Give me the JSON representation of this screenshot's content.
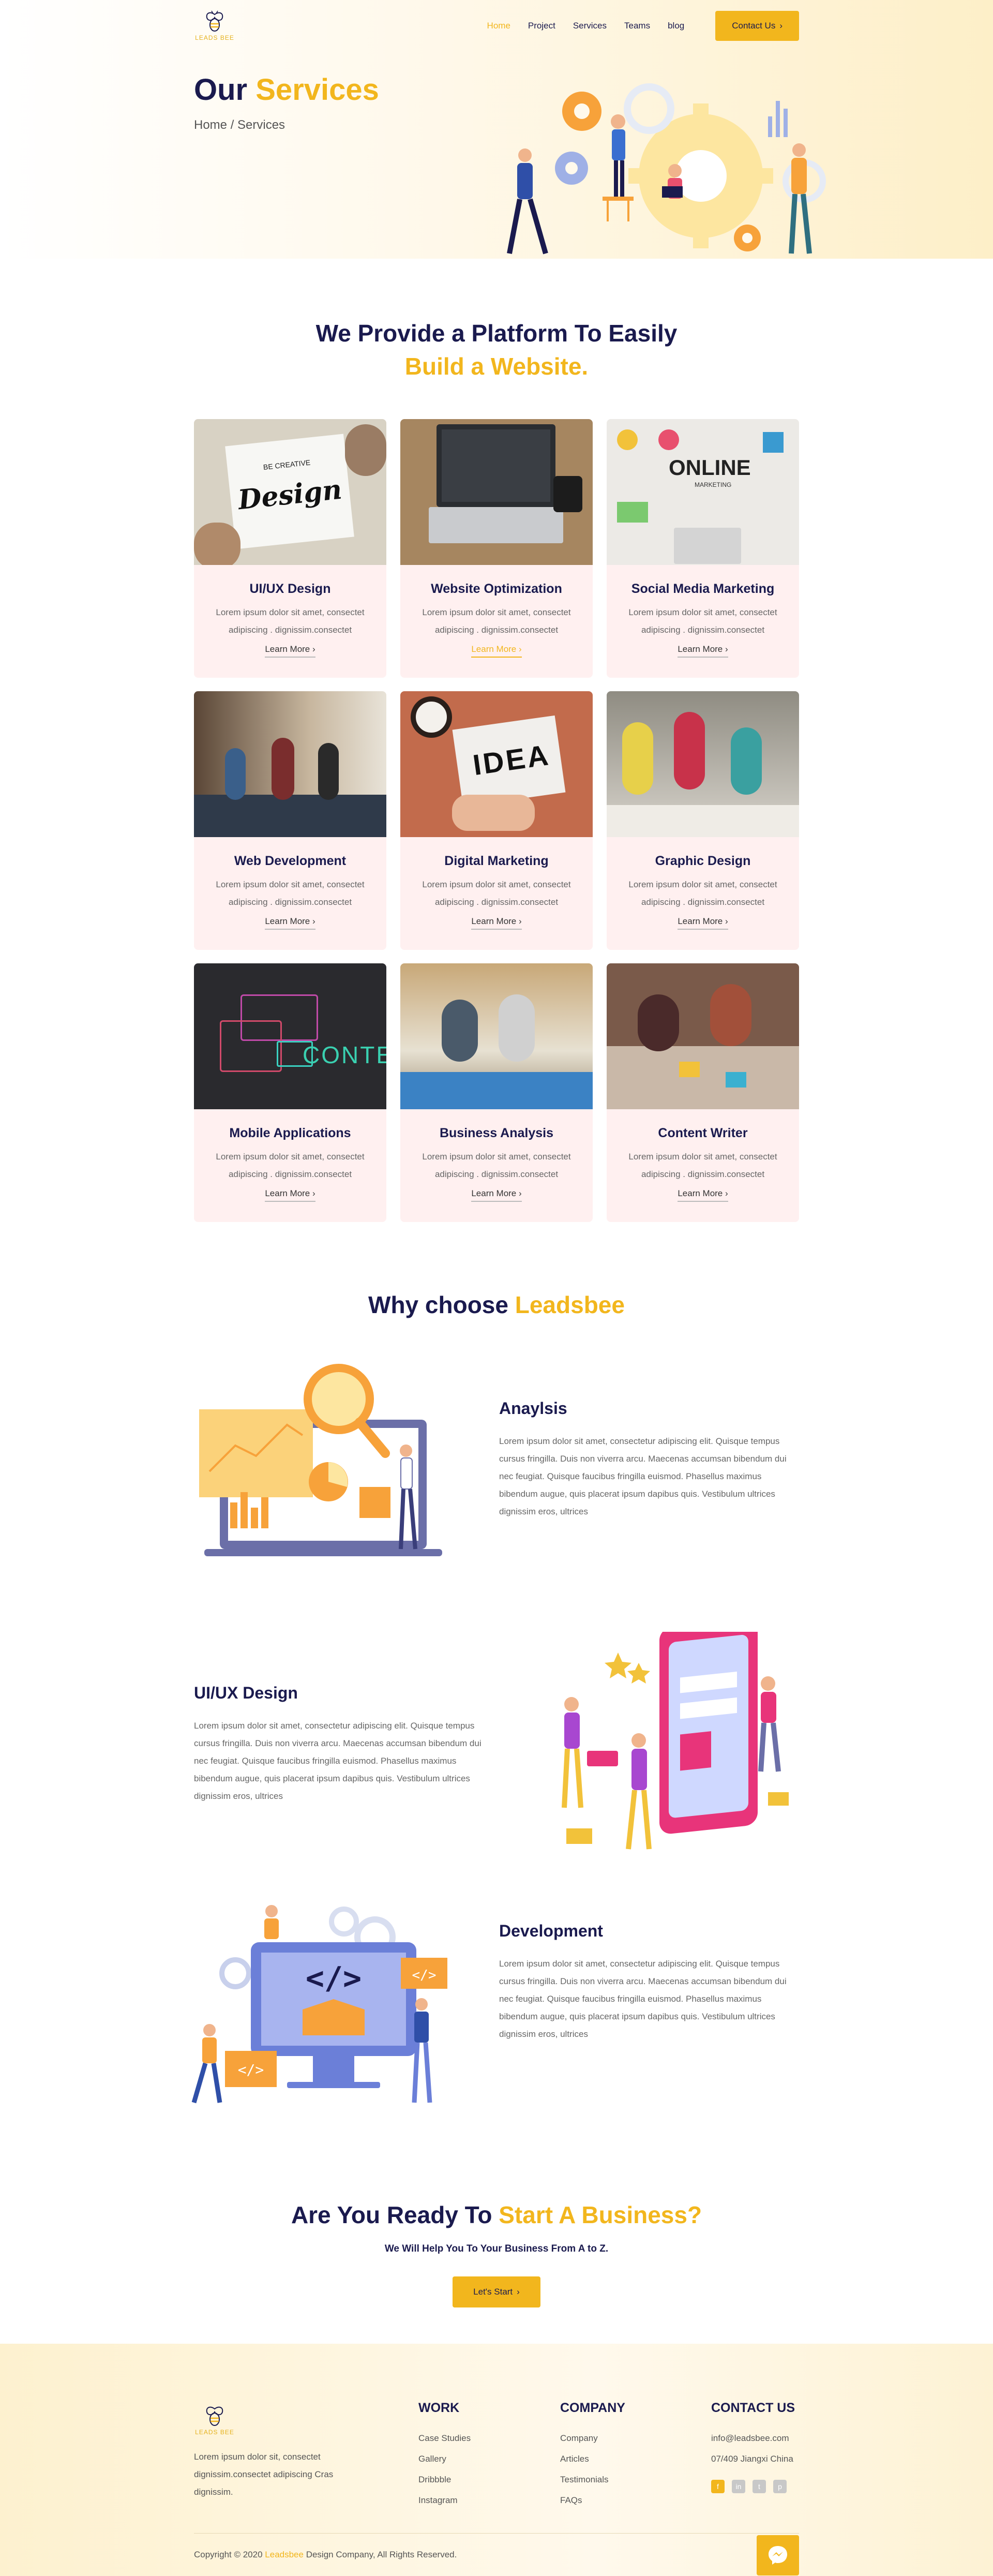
{
  "brand": {
    "name": "LEADS BEE",
    "accent": "#f2b61d",
    "navy": "#1a1a4e"
  },
  "nav": {
    "items": [
      {
        "label": "Home",
        "active": true
      },
      {
        "label": "Project"
      },
      {
        "label": "Services"
      },
      {
        "label": "Teams"
      },
      {
        "label": "blog"
      }
    ],
    "cta": "Contact Us"
  },
  "hero": {
    "title_a": "Our",
    "title_b": "Services",
    "breadcrumb": "Home / Services"
  },
  "services": {
    "title_a": "We Provide a Platform To Easily",
    "title_b": "Build a Website.",
    "cards": [
      {
        "title": "UI/UX Design",
        "text": "Lorem ipsum dolor sit amet, consectet adipiscing . dignissim.consectet",
        "link": "Learn More",
        "image_text": "Design",
        "image_caption": "BE CREATIVE"
      },
      {
        "title": "Website Optimization",
        "text": "Lorem ipsum dolor sit amet, consectet adipiscing . dignissim.consectet",
        "link": "Learn More",
        "active": true
      },
      {
        "title": "Social Media Marketing",
        "text": "Lorem ipsum dolor sit amet, consectet adipiscing . dignissim.consectet",
        "link": "Learn More",
        "image_text": "ONLINE",
        "image_caption": "MARKETING"
      },
      {
        "title": "Web Development",
        "text": "Lorem ipsum dolor sit amet, consectet adipiscing . dignissim.consectet",
        "link": "Learn More"
      },
      {
        "title": "Digital Marketing",
        "text": "Lorem ipsum dolor sit amet, consectet adipiscing . dignissim.consectet",
        "link": "Learn More",
        "image_text": "IDEA"
      },
      {
        "title": "Graphic Design",
        "text": "Lorem ipsum dolor sit amet, consectet adipiscing . dignissim.consectet",
        "link": "Learn More"
      },
      {
        "title": "Mobile Applications",
        "text": "Lorem ipsum dolor sit amet, consectet adipiscing . dignissim.consectet",
        "link": "Learn More",
        "image_text": "CONTEN"
      },
      {
        "title": "Business Analysis",
        "text": "Lorem ipsum dolor sit amet, consectet adipiscing . dignissim.consectet",
        "link": "Learn More"
      },
      {
        "title": "Content Writer",
        "text": "Lorem ipsum dolor sit amet, consectet adipiscing . dignissim.consectet",
        "link": "Learn More"
      }
    ]
  },
  "why": {
    "title_a": "Why choose",
    "title_b": "Leadsbee",
    "features": [
      {
        "title": "Anaylsis",
        "text": "Lorem ipsum dolor sit amet, consectetur adipiscing elit. Quisque tempus cursus fringilla. Duis non viverra arcu. Maecenas accumsan bibendum dui nec feugiat. Quisque faucibus fringilla euismod. Phasellus maximus bibendum augue, quis placerat ipsum dapibus quis. Vestibulum ultrices dignissim eros, ultrices"
      },
      {
        "title": "UI/UX Design",
        "text": "Lorem ipsum dolor sit amet, consectetur adipiscing elit. Quisque tempus cursus fringilla. Duis non viverra arcu. Maecenas accumsan bibendum dui nec feugiat. Quisque faucibus fringilla euismod. Phasellus maximus bibendum augue, quis placerat ipsum dapibus quis. Vestibulum ultrices dignissim eros, ultrices"
      },
      {
        "title": "Development",
        "text": "Lorem ipsum dolor sit amet, consectetur adipiscing elit. Quisque tempus cursus fringilla. Duis non viverra arcu. Maecenas accumsan bibendum dui nec feugiat. Quisque faucibus fringilla euismod. Phasellus maximus bibendum augue, quis placerat ipsum dapibus quis. Vestibulum ultrices dignissim eros, ultrices"
      }
    ]
  },
  "ready": {
    "title_a": "Are You Ready To",
    "title_b": "Start A Business?",
    "subtitle": "We Will Help You To Your Business From A to Z.",
    "cta": "Let's Start"
  },
  "footer": {
    "about": "Lorem ipsum dolor sit, consectet dignissim.consectet adipiscing Cras dignissim.",
    "work": {
      "title": "WORK",
      "items": [
        "Case Studies",
        "Gallery",
        "Dribbble",
        "Instagram"
      ]
    },
    "company": {
      "title": "COMPANY",
      "items": [
        "Company",
        "Articles",
        "Testimonials",
        "FAQs"
      ]
    },
    "contact": {
      "title": "CONTACT US",
      "email": "info@leadsbee.com",
      "address": "07/409 Jiangxi China"
    },
    "copy_a": "Copyright © 2020",
    "copy_brand": "Leadsbee",
    "copy_b": "Design Company, All Rights Reserved."
  }
}
